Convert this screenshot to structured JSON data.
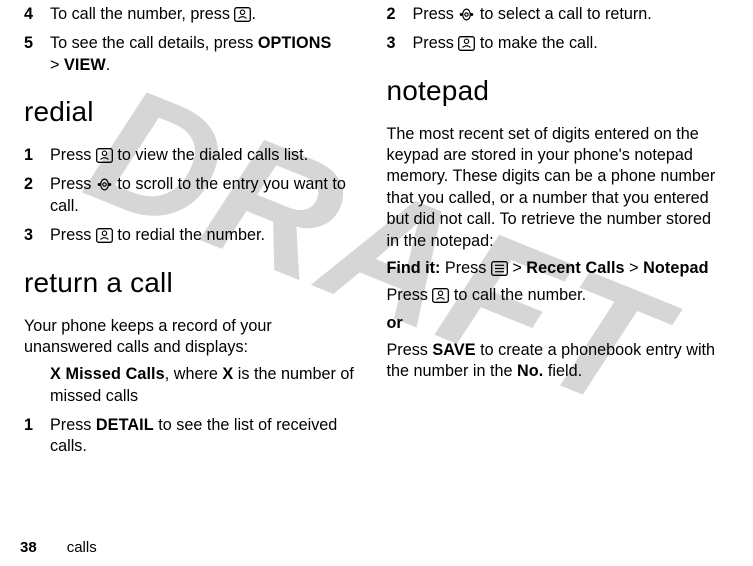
{
  "watermark": "DRAFT",
  "left": {
    "step4": {
      "num": "4",
      "pre": "To call the number, press ",
      "post": "."
    },
    "step5": {
      "num": "5",
      "pre": "To see the call details, press ",
      "options": "OPTIONS",
      "gt": ">",
      "view": "VIEW",
      "post": "."
    },
    "redial_heading": "redial",
    "r1": {
      "num": "1",
      "pre": "Press ",
      "post": " to view the dialed calls list."
    },
    "r2": {
      "num": "2",
      "pre": "Press ",
      "post": " to scroll to the entry you want to call."
    },
    "r3": {
      "num": "3",
      "pre": "Press ",
      "post": " to redial the number."
    },
    "return_heading": "return a call",
    "return_p1": "Your phone keeps a record of your unanswered calls and displays:",
    "return_missed_pre": "X Missed Calls",
    "return_missed_mid": ", where ",
    "return_missed_x": "X",
    "return_missed_post": " is the number of missed calls",
    "ret1": {
      "num": "1",
      "pre": "Press ",
      "detail": "DETAIL",
      "post": " to see the list of received calls."
    }
  },
  "right": {
    "ret2": {
      "num": "2",
      "pre": "Press ",
      "post": " to select a call to return."
    },
    "ret3": {
      "num": "3",
      "pre": "Press ",
      "post": " to make the call."
    },
    "notepad_heading": "notepad",
    "notepad_p1": "The most recent set of digits entered on the keypad are stored in your phone's notepad memory. These digits can be a phone number that you called, or a number that you entered but did not call. To retrieve the number stored in the notepad:",
    "findit_label": "Find it:",
    "findit_pre": " Press ",
    "findit_recent": "Recent Calls",
    "findit_notepad": "Notepad",
    "gt": ">",
    "np_press": "Press ",
    "np_post": " to call the number.",
    "or": "or",
    "save_pre": "Press ",
    "save": "SAVE",
    "save_mid": " to create a phonebook entry with the number in the ",
    "no_field": "No.",
    "save_post": " field."
  },
  "footer": {
    "page": "38",
    "section": "calls"
  }
}
